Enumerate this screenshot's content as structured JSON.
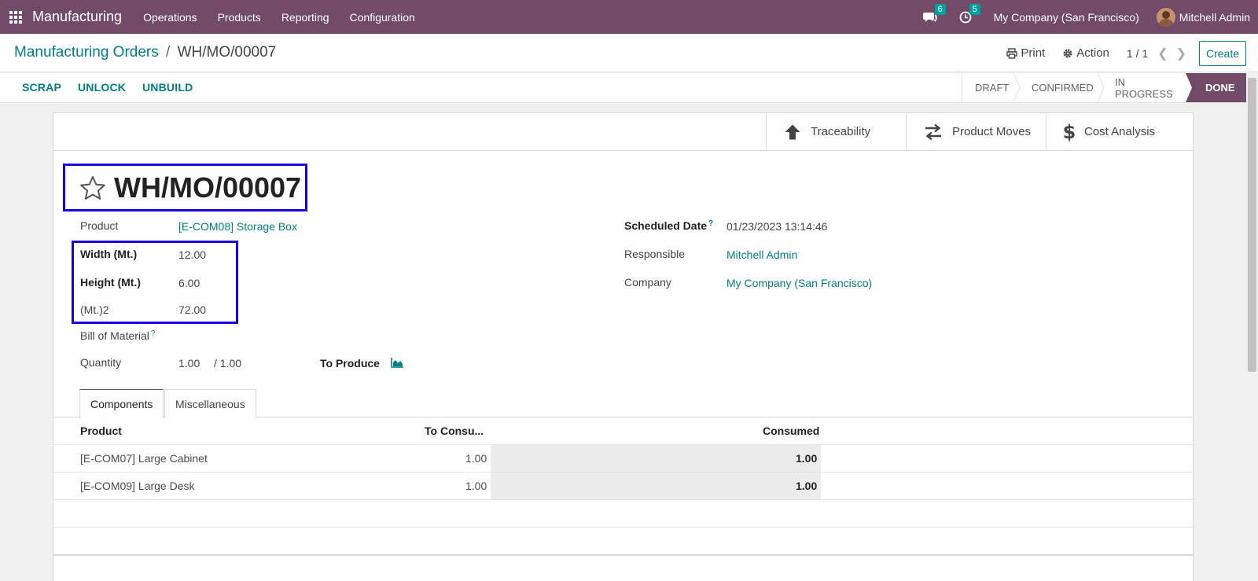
{
  "navbar": {
    "app_name": "Manufacturing",
    "menu": [
      "Operations",
      "Products",
      "Reporting",
      "Configuration"
    ],
    "messages_count": "6",
    "activities_count": "5",
    "company": "My Company (San Francisco)",
    "user": "Mitchell Admin"
  },
  "control": {
    "breadcrumb_parent": "Manufacturing Orders",
    "breadcrumb_sep": "/",
    "breadcrumb_current": "WH/MO/00007",
    "print_label": "Print",
    "action_label": "Action",
    "pager": "1 / 1",
    "create_label": "Create"
  },
  "statusbar": {
    "buttons": [
      "SCRAP",
      "UNLOCK",
      "UNBUILD"
    ],
    "stages": [
      "DRAFT",
      "CONFIRMED",
      "IN PROGRESS",
      "DONE"
    ],
    "current_stage": "DONE"
  },
  "smart_buttons": [
    "Traceability",
    "Product Moves",
    "Cost Analysis"
  ],
  "record": {
    "title": "WH/MO/00007",
    "product_label": "Product",
    "product_value": "[E-COM08] Storage Box",
    "width_label": "Width (Mt.)",
    "width_value": "12.00",
    "height_label": "Height (Mt.)",
    "height_value": "6.00",
    "area_label": "(Mt.)2",
    "area_value": "72.00",
    "bom_label": "Bill of Material",
    "help_mark": "?",
    "quantity_label": "Quantity",
    "quantity_value": "1.00",
    "quantity_total": "/ 1.00",
    "to_produce_label": "To Produce",
    "scheduled_label": "Scheduled Date",
    "scheduled_value": "01/23/2023 13:14:46",
    "responsible_label": "Responsible",
    "responsible_value": "Mitchell Admin",
    "company_label": "Company",
    "company_value": "My Company (San Francisco)"
  },
  "tabs": [
    "Components",
    "Miscellaneous"
  ],
  "components": {
    "headers": [
      "Product",
      "To Consu...",
      "Consumed"
    ],
    "rows": [
      {
        "product": "[E-COM07] Large Cabinet",
        "to_consume": "1.00",
        "consumed": "1.00"
      },
      {
        "product": "[E-COM09] Large Desk",
        "to_consume": "1.00",
        "consumed": "1.00"
      }
    ]
  },
  "colors": {
    "navbar": "#714b67",
    "accent": "#017e84",
    "highlight_box": "#1a00e0"
  }
}
